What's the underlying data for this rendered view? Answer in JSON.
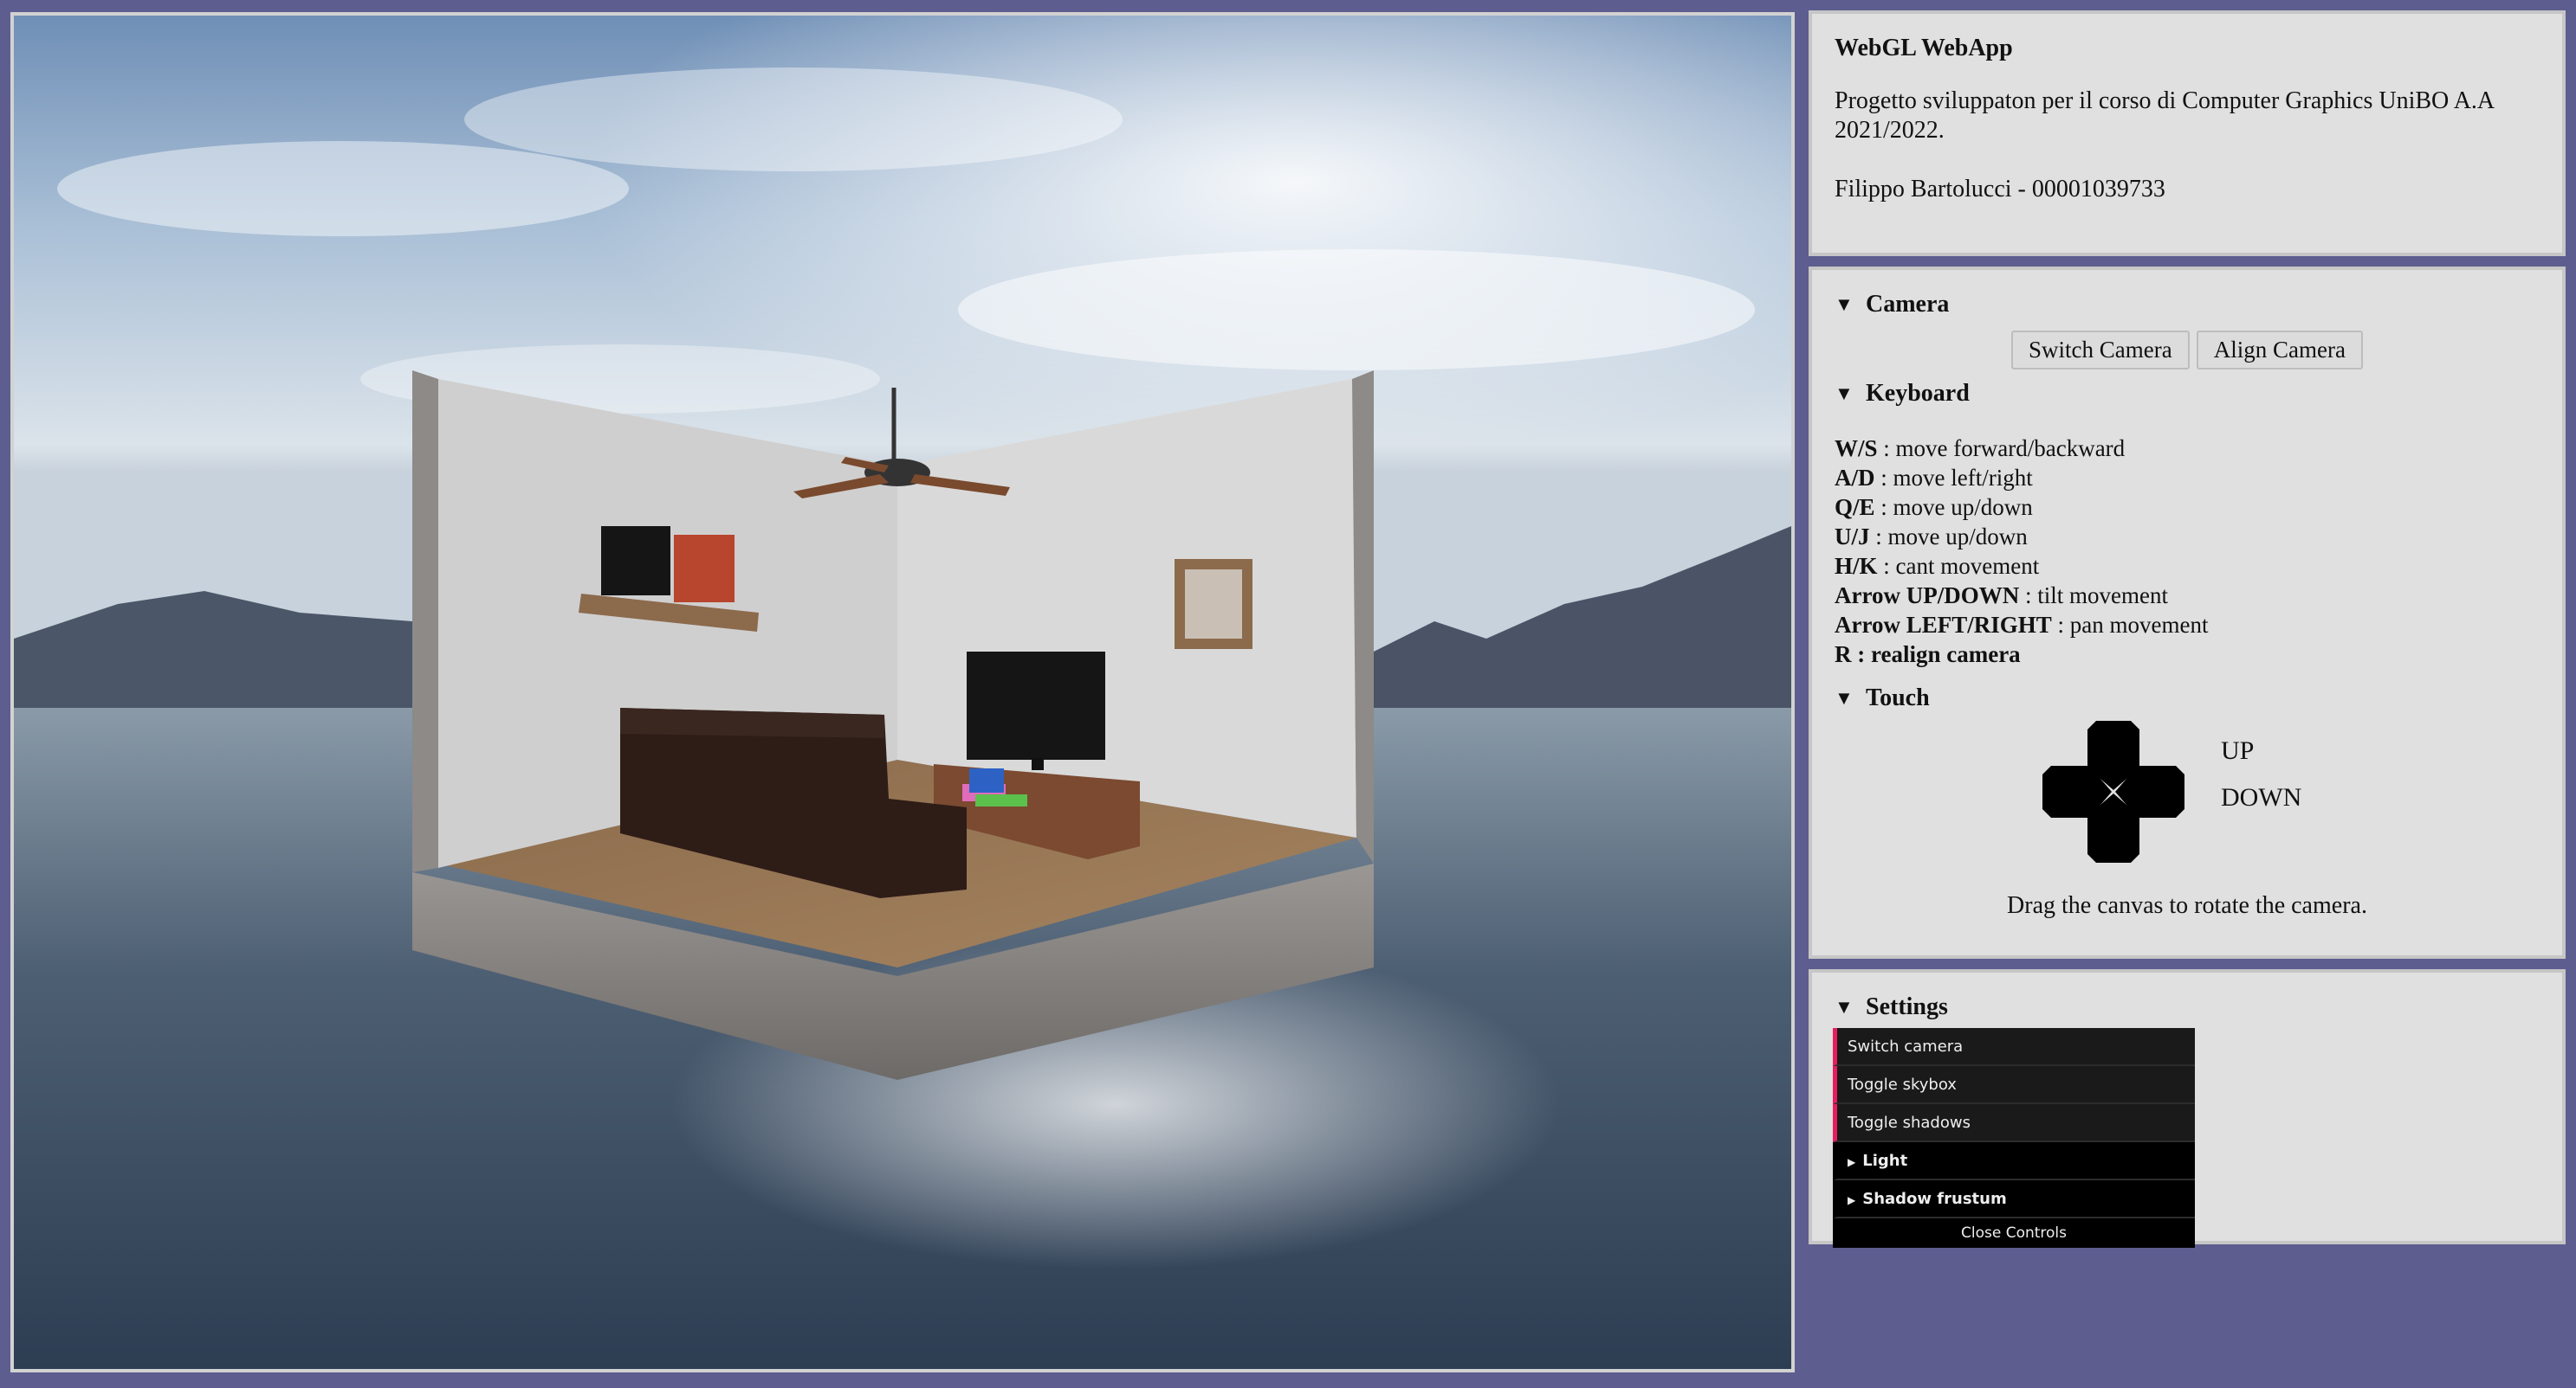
{
  "info": {
    "title": "WebGL WebApp",
    "description": "Progetto sviluppaton per il corso di Computer Graphics UniBO A.A 2021/2022.",
    "author": "Filippo Bartolucci - 00001039733"
  },
  "camera": {
    "heading": "Camera",
    "switch_label": "Switch Camera",
    "align_label": "Align Camera"
  },
  "keyboard": {
    "heading": "Keyboard",
    "keys": [
      {
        "key": "W/S",
        "desc": " : move forward/backward"
      },
      {
        "key": "A/D",
        "desc": " : move left/right"
      },
      {
        "key": "Q/E",
        "desc": " : move up/down"
      },
      {
        "key": "U/J",
        "desc": " : move up/down"
      },
      {
        "key": "H/K",
        "desc": " : cant movement"
      },
      {
        "key": "Arrow UP/DOWN",
        "desc": " : tilt movement"
      },
      {
        "key": "Arrow LEFT/RIGHT",
        "desc": " : pan movement"
      },
      {
        "key": "R : realign camera",
        "desc": ""
      }
    ]
  },
  "touch": {
    "heading": "Touch",
    "up_label": "UP",
    "down_label": "DOWN",
    "drag_hint": "Drag the canvas to rotate the camera."
  },
  "settings": {
    "heading": "Settings",
    "gui": {
      "switch_camera": "Switch camera",
      "toggle_skybox": "Toggle skybox",
      "toggle_shadows": "Toggle shadows",
      "light_folder": "Light",
      "shadow_folder": "Shadow frustum",
      "close_controls": "Close Controls"
    }
  },
  "icons": {
    "collapse": "triangle-down-icon",
    "folder": "triangle-right-icon",
    "dpad": "dpad-icon"
  },
  "colors": {
    "page_bg": "#5e5d8f",
    "panel_bg": "#e0e0e0",
    "gui_accent": "#e61d5f"
  }
}
